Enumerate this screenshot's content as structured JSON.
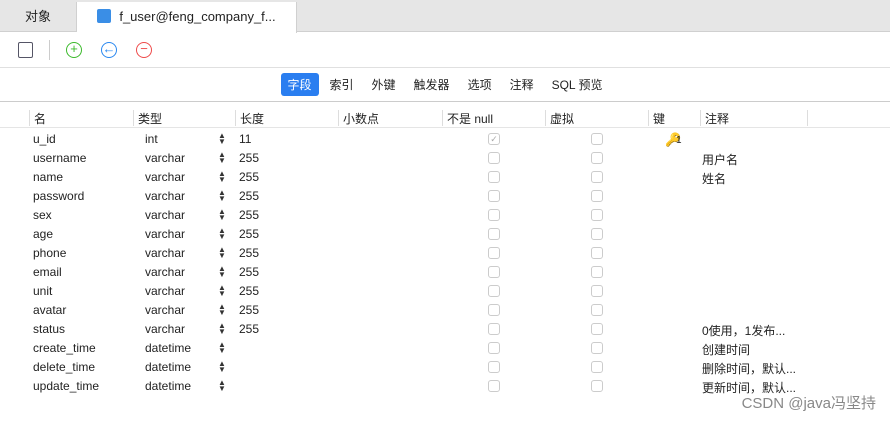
{
  "tabs": {
    "objects": "对象",
    "active": "f_user@feng_company_f..."
  },
  "subtabs": [
    "字段",
    "索引",
    "外键",
    "触发器",
    "选项",
    "注释",
    "SQL 预览"
  ],
  "headers": [
    "名",
    "类型",
    "长度",
    "小数点",
    "不是 null",
    "虚拟",
    "键",
    "注释"
  ],
  "rows": [
    {
      "name": "u_id",
      "type": "int",
      "length": "11",
      "decimal": "",
      "notnull": true,
      "virtual": false,
      "key": "1",
      "comment": ""
    },
    {
      "name": "username",
      "type": "varchar",
      "length": "255",
      "decimal": "",
      "notnull": false,
      "virtual": false,
      "key": "",
      "comment": "用户名"
    },
    {
      "name": "name",
      "type": "varchar",
      "length": "255",
      "decimal": "",
      "notnull": false,
      "virtual": false,
      "key": "",
      "comment": "姓名"
    },
    {
      "name": "password",
      "type": "varchar",
      "length": "255",
      "decimal": "",
      "notnull": false,
      "virtual": false,
      "key": "",
      "comment": ""
    },
    {
      "name": "sex",
      "type": "varchar",
      "length": "255",
      "decimal": "",
      "notnull": false,
      "virtual": false,
      "key": "",
      "comment": ""
    },
    {
      "name": "age",
      "type": "varchar",
      "length": "255",
      "decimal": "",
      "notnull": false,
      "virtual": false,
      "key": "",
      "comment": ""
    },
    {
      "name": "phone",
      "type": "varchar",
      "length": "255",
      "decimal": "",
      "notnull": false,
      "virtual": false,
      "key": "",
      "comment": ""
    },
    {
      "name": "email",
      "type": "varchar",
      "length": "255",
      "decimal": "",
      "notnull": false,
      "virtual": false,
      "key": "",
      "comment": ""
    },
    {
      "name": "unit",
      "type": "varchar",
      "length": "255",
      "decimal": "",
      "notnull": false,
      "virtual": false,
      "key": "",
      "comment": ""
    },
    {
      "name": "avatar",
      "type": "varchar",
      "length": "255",
      "decimal": "",
      "notnull": false,
      "virtual": false,
      "key": "",
      "comment": ""
    },
    {
      "name": "status",
      "type": "varchar",
      "length": "255",
      "decimal": "",
      "notnull": false,
      "virtual": false,
      "key": "",
      "comment": "0使用，1发布..."
    },
    {
      "name": "create_time",
      "type": "datetime",
      "length": "",
      "decimal": "",
      "notnull": false,
      "virtual": false,
      "key": "",
      "comment": "创建时间"
    },
    {
      "name": "delete_time",
      "type": "datetime",
      "length": "",
      "decimal": "",
      "notnull": false,
      "virtual": false,
      "key": "",
      "comment": "删除时间，默认..."
    },
    {
      "name": "update_time",
      "type": "datetime",
      "length": "",
      "decimal": "",
      "notnull": false,
      "virtual": false,
      "key": "",
      "comment": "更新时间，默认..."
    }
  ],
  "watermark": "CSDN @java冯坚持"
}
